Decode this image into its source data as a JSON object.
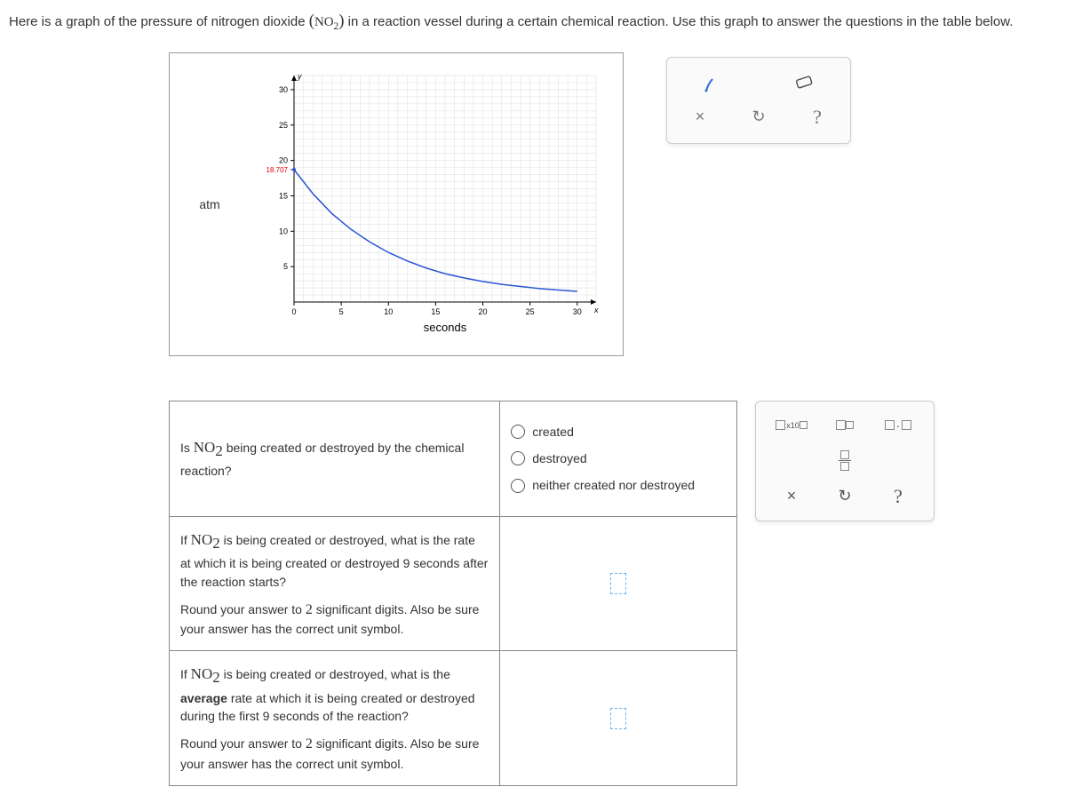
{
  "prompt": {
    "part1": "Here is a graph of the pressure of nitrogen dioxide ",
    "chem_paren_open": "(",
    "chem_main": "NO",
    "chem_sub": "2",
    "chem_paren_close": ")",
    "part2": " in a reaction vessel during a certain chemical reaction. Use this graph to answer the questions in the table below."
  },
  "chart_data": {
    "type": "line",
    "xlabel": "seconds",
    "ylabel": "atm",
    "x_ticks": [
      0,
      5,
      10,
      15,
      20,
      25,
      30
    ],
    "y_ticks": [
      5,
      10,
      15,
      20,
      25,
      30
    ],
    "y_marker": 18.707,
    "y_marker_label": "18.707",
    "points_x": [
      0,
      2,
      4,
      6,
      8,
      10,
      12,
      14,
      16,
      18,
      20,
      22,
      24,
      26,
      28,
      30
    ],
    "points_y": [
      18.7,
      15.3,
      12.5,
      10.3,
      8.5,
      7.0,
      5.8,
      4.8,
      4.0,
      3.4,
      2.9,
      2.5,
      2.2,
      1.9,
      1.7,
      1.5
    ],
    "xlim": [
      0,
      32
    ],
    "ylim": [
      0,
      32
    ]
  },
  "toolbox1": {
    "pencil": "pencil-icon",
    "eraser": "eraser-icon",
    "close": "×",
    "refresh": "↻",
    "help": "?"
  },
  "questions": {
    "q1": {
      "prefix": "Is ",
      "chem": "NO",
      "chemsub": "2",
      "suffix": " being created or destroyed by the chemical reaction?",
      "opt1": "created",
      "opt2": "destroyed",
      "opt3": "neither created nor destroyed"
    },
    "q2": {
      "prefix": "If ",
      "chem": "NO",
      "chemsub": "2",
      "l1": " is being created or destroyed, what is the rate at which it is being created or destroyed 9 seconds after the reaction starts?",
      "l2a": "Round your answer to ",
      "l2num": "2",
      "l2b": " significant digits. Also be sure your answer has the correct unit symbol."
    },
    "q3": {
      "prefix": "If ",
      "chem": "NO",
      "chemsub": "2",
      "l1a": " is being created or destroyed, what is the ",
      "l1bold": "average",
      "l1b": " rate at which it is being created or destroyed during the first 9 seconds of the reaction?",
      "l2a": "Round your answer to ",
      "l2num": "2",
      "l2b": " significant digits. Also be sure your answer has the correct unit symbol."
    }
  },
  "toolbox2": {
    "x10": "x10",
    "dot": "·",
    "close": "×",
    "refresh": "↻",
    "help": "?"
  }
}
